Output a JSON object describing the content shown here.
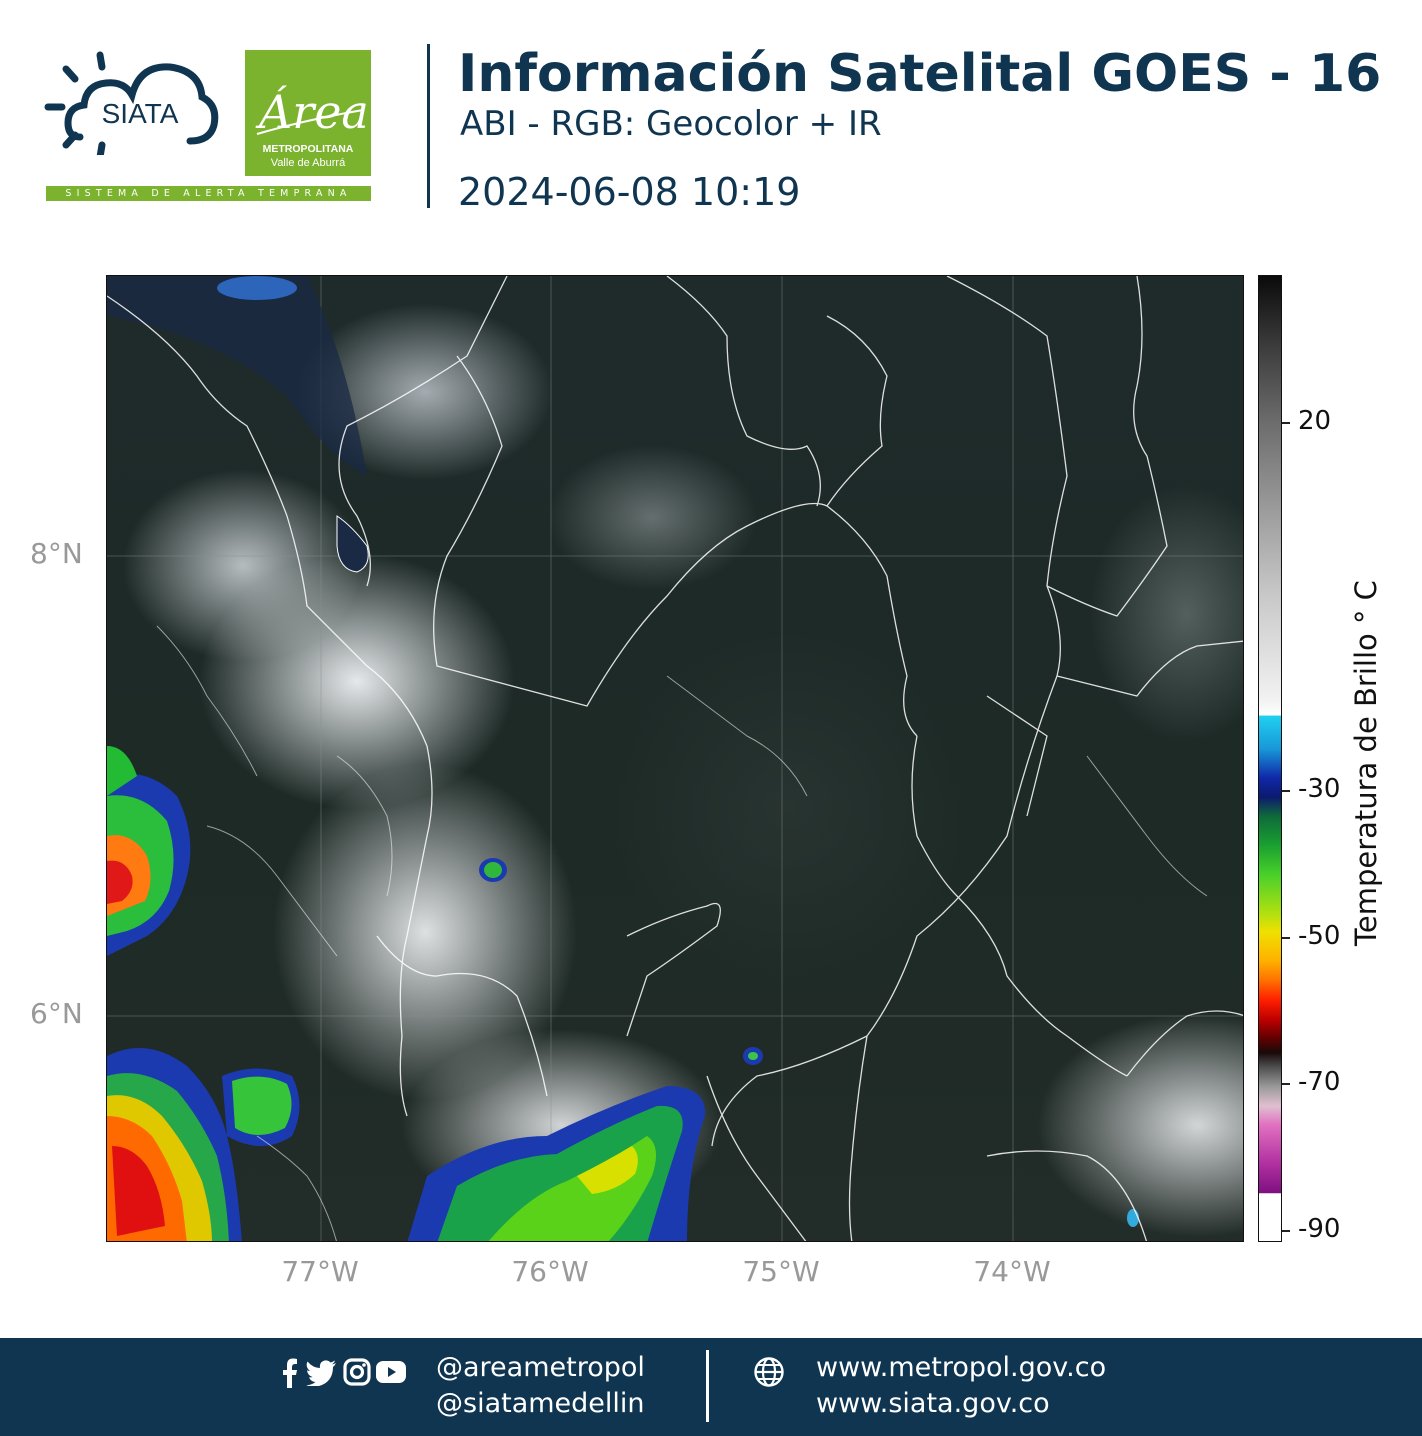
{
  "header": {
    "siata_logo_text": "SIATA",
    "siata_tagline": "SISTEMA DE ALERTA TEMPRANA",
    "area_logo_script": "Área",
    "area_logo_line1": "METROPOLITANA",
    "area_logo_line2": "Valle de Aburrá",
    "title": "Información Satelital GOES - 16",
    "subtitle": "ABI - RGB: Geocolor + IR",
    "timestamp": "2024-06-08 10:19"
  },
  "map": {
    "lat_labels": [
      "8°N",
      "6°N"
    ],
    "lon_labels": [
      "77°W",
      "76°W",
      "75°W",
      "74°W"
    ],
    "colorbar": {
      "title": "Temperatura de Brillo ° C",
      "ticks": [
        "20",
        "-30",
        "-50",
        "-70",
        "-90"
      ]
    }
  },
  "footer": {
    "social_handle_1": "@areametropol",
    "social_handle_2": "@siatamedellin",
    "website_1": "www.metropol.gov.co",
    "website_2": "www.siata.gov.co",
    "icons": [
      "facebook-icon",
      "twitter-icon",
      "instagram-icon",
      "youtube-icon",
      "globe-icon"
    ]
  }
}
